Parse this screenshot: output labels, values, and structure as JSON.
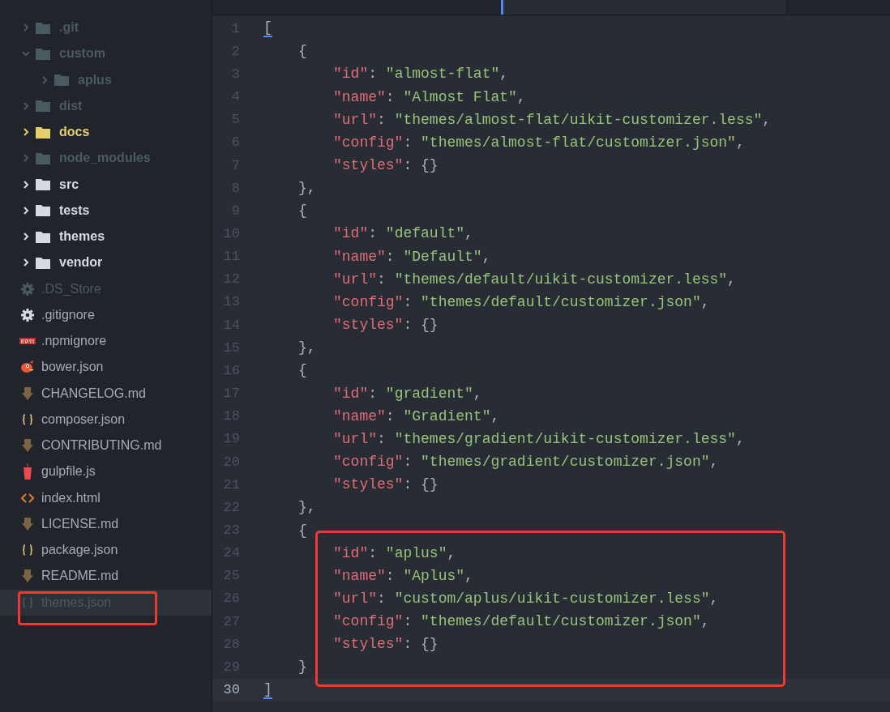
{
  "sidebar": {
    "items": [
      {
        "name": ".git",
        "kind": "folder",
        "ignored": true,
        "modified": false,
        "expanded": false,
        "selected": false
      },
      {
        "name": "custom",
        "kind": "folder",
        "ignored": true,
        "modified": false,
        "expanded": true,
        "selected": false,
        "children": [
          {
            "name": "aplus",
            "kind": "folder",
            "ignored": true,
            "modified": false,
            "expanded": false,
            "selected": false
          }
        ]
      },
      {
        "name": "dist",
        "kind": "folder",
        "ignored": true,
        "modified": false,
        "expanded": false,
        "selected": false
      },
      {
        "name": "docs",
        "kind": "folder",
        "ignored": false,
        "modified": true,
        "expanded": false,
        "selected": false
      },
      {
        "name": "node_modules",
        "kind": "folder",
        "ignored": true,
        "modified": false,
        "expanded": false,
        "selected": false
      },
      {
        "name": "src",
        "kind": "folder",
        "ignored": false,
        "modified": false,
        "expanded": false,
        "selected": false
      },
      {
        "name": "tests",
        "kind": "folder",
        "ignored": false,
        "modified": false,
        "expanded": false,
        "selected": false
      },
      {
        "name": "themes",
        "kind": "folder",
        "ignored": false,
        "modified": false,
        "expanded": false,
        "selected": false
      },
      {
        "name": "vendor",
        "kind": "folder",
        "ignored": false,
        "modified": false,
        "expanded": false,
        "selected": false
      },
      {
        "name": ".DS_Store",
        "kind": "settings",
        "ignored": true,
        "modified": false,
        "selected": false
      },
      {
        "name": ".gitignore",
        "kind": "settings",
        "ignored": false,
        "modified": false,
        "selected": false
      },
      {
        "name": ".npmignore",
        "kind": "npm",
        "ignored": false,
        "modified": false,
        "selected": false
      },
      {
        "name": "bower.json",
        "kind": "bower",
        "ignored": false,
        "modified": false,
        "selected": false
      },
      {
        "name": "CHANGELOG.md",
        "kind": "markdown",
        "ignored": false,
        "modified": false,
        "selected": false
      },
      {
        "name": "composer.json",
        "kind": "json",
        "ignored": false,
        "modified": false,
        "selected": false
      },
      {
        "name": "CONTRIBUTING.md",
        "kind": "markdown",
        "ignored": false,
        "modified": false,
        "selected": false
      },
      {
        "name": "gulpfile.js",
        "kind": "gulp",
        "ignored": false,
        "modified": false,
        "selected": false
      },
      {
        "name": "index.html",
        "kind": "html",
        "ignored": false,
        "modified": false,
        "selected": false
      },
      {
        "name": "LICENSE.md",
        "kind": "markdown",
        "ignored": false,
        "modified": false,
        "selected": false
      },
      {
        "name": "package.json",
        "kind": "json",
        "ignored": false,
        "modified": false,
        "selected": false
      },
      {
        "name": "README.md",
        "kind": "markdown",
        "ignored": false,
        "modified": false,
        "selected": false
      },
      {
        "kind": "highlight",
        "items": [
          {
            "name": "themes.json",
            "kind": "json",
            "ignored": true,
            "modified": false,
            "selected": true
          }
        ]
      }
    ]
  },
  "editor": {
    "lines": [
      {
        "number": "1",
        "kind": "bracket",
        "current": false,
        "tokens": [
          {
            "text": "[",
            "kind": "bracket-match"
          }
        ]
      },
      {
        "number": "2",
        "kind": "brace",
        "current": false,
        "tokens": [
          {
            "text": "{",
            "kind": "punct"
          }
        ]
      },
      {
        "number": "3",
        "kind": "property",
        "current": false,
        "tokens": [
          {
            "text": "\"id\"",
            "kind": "key"
          },
          {
            "text": ": ",
            "kind": "punct"
          },
          {
            "text": "\"almost-flat\"",
            "kind": "string"
          },
          {
            "text": ",",
            "kind": "punct"
          }
        ]
      },
      {
        "number": "4",
        "kind": "property",
        "current": false,
        "tokens": [
          {
            "text": "\"name\"",
            "kind": "key"
          },
          {
            "text": ": ",
            "kind": "punct"
          },
          {
            "text": "\"Almost Flat\"",
            "kind": "string"
          },
          {
            "text": ",",
            "kind": "punct"
          }
        ]
      },
      {
        "number": "5",
        "kind": "property",
        "current": false,
        "tokens": [
          {
            "text": "\"url\"",
            "kind": "key"
          },
          {
            "text": ": ",
            "kind": "punct"
          },
          {
            "text": "\"themes/almost-flat/uikit-customizer.less\"",
            "kind": "string"
          },
          {
            "text": ",",
            "kind": "punct"
          }
        ]
      },
      {
        "number": "6",
        "kind": "property",
        "current": false,
        "tokens": [
          {
            "text": "\"config\"",
            "kind": "key"
          },
          {
            "text": ": ",
            "kind": "punct"
          },
          {
            "text": "\"themes/almost-flat/customizer.json\"",
            "kind": "string"
          },
          {
            "text": ",",
            "kind": "punct"
          }
        ]
      },
      {
        "number": "7",
        "kind": "property",
        "current": false,
        "tokens": [
          {
            "text": "\"styles\"",
            "kind": "key"
          },
          {
            "text": ": {}",
            "kind": "punct"
          }
        ]
      },
      {
        "number": "8",
        "kind": "brace",
        "current": false,
        "tokens": [
          {
            "text": "},",
            "kind": "punct"
          }
        ]
      },
      {
        "number": "9",
        "kind": "brace",
        "current": false,
        "tokens": [
          {
            "text": "{",
            "kind": "punct"
          }
        ]
      },
      {
        "number": "10",
        "kind": "property",
        "current": false,
        "tokens": [
          {
            "text": "\"id\"",
            "kind": "key"
          },
          {
            "text": ": ",
            "kind": "punct"
          },
          {
            "text": "\"default\"",
            "kind": "string"
          },
          {
            "text": ",",
            "kind": "punct"
          }
        ]
      },
      {
        "number": "11",
        "kind": "property",
        "current": false,
        "tokens": [
          {
            "text": "\"name\"",
            "kind": "key"
          },
          {
            "text": ": ",
            "kind": "punct"
          },
          {
            "text": "\"Default\"",
            "kind": "string"
          },
          {
            "text": ",",
            "kind": "punct"
          }
        ]
      },
      {
        "number": "12",
        "kind": "property",
        "current": false,
        "tokens": [
          {
            "text": "\"url\"",
            "kind": "key"
          },
          {
            "text": ": ",
            "kind": "punct"
          },
          {
            "text": "\"themes/default/uikit-customizer.less\"",
            "kind": "string"
          },
          {
            "text": ",",
            "kind": "punct"
          }
        ]
      },
      {
        "number": "13",
        "kind": "property",
        "current": false,
        "tokens": [
          {
            "text": "\"config\"",
            "kind": "key"
          },
          {
            "text": ": ",
            "kind": "punct"
          },
          {
            "text": "\"themes/default/customizer.json\"",
            "kind": "string"
          },
          {
            "text": ",",
            "kind": "punct"
          }
        ]
      },
      {
        "number": "14",
        "kind": "property",
        "current": false,
        "tokens": [
          {
            "text": "\"styles\"",
            "kind": "key"
          },
          {
            "text": ": {}",
            "kind": "punct"
          }
        ]
      },
      {
        "number": "15",
        "kind": "brace",
        "current": false,
        "tokens": [
          {
            "text": "},",
            "kind": "punct"
          }
        ]
      },
      {
        "number": "16",
        "kind": "brace",
        "current": false,
        "tokens": [
          {
            "text": "{",
            "kind": "punct"
          }
        ]
      },
      {
        "number": "17",
        "kind": "property",
        "current": false,
        "tokens": [
          {
            "text": "\"id\"",
            "kind": "key"
          },
          {
            "text": ": ",
            "kind": "punct"
          },
          {
            "text": "\"gradient\"",
            "kind": "string"
          },
          {
            "text": ",",
            "kind": "punct"
          }
        ]
      },
      {
        "number": "18",
        "kind": "property",
        "current": false,
        "tokens": [
          {
            "text": "\"name\"",
            "kind": "key"
          },
          {
            "text": ": ",
            "kind": "punct"
          },
          {
            "text": "\"Gradient\"",
            "kind": "string"
          },
          {
            "text": ",",
            "kind": "punct"
          }
        ]
      },
      {
        "number": "19",
        "kind": "property",
        "current": false,
        "tokens": [
          {
            "text": "\"url\"",
            "kind": "key"
          },
          {
            "text": ": ",
            "kind": "punct"
          },
          {
            "text": "\"themes/gradient/uikit-customizer.less\"",
            "kind": "string"
          },
          {
            "text": ",",
            "kind": "punct"
          }
        ]
      },
      {
        "number": "20",
        "kind": "property",
        "current": false,
        "tokens": [
          {
            "text": "\"config\"",
            "kind": "key"
          },
          {
            "text": ": ",
            "kind": "punct"
          },
          {
            "text": "\"themes/gradient/customizer.json\"",
            "kind": "string"
          },
          {
            "text": ",",
            "kind": "punct"
          }
        ]
      },
      {
        "number": "21",
        "kind": "property",
        "current": false,
        "tokens": [
          {
            "text": "\"styles\"",
            "kind": "key"
          },
          {
            "text": ": {}",
            "kind": "punct"
          }
        ]
      },
      {
        "number": "22",
        "kind": "brace",
        "current": false,
        "tokens": [
          {
            "text": "},",
            "kind": "punct"
          }
        ]
      },
      {
        "number": "23",
        "kind": "brace",
        "current": false,
        "tokens": [
          {
            "text": "{",
            "kind": "punct"
          }
        ]
      },
      {
        "kind": "highlight",
        "lines": [
          {
            "number": "24",
            "kind": "property",
            "current": false,
            "tokens": [
              {
                "text": "\"id\"",
                "kind": "key"
              },
              {
                "text": ": ",
                "kind": "punct"
              },
              {
                "text": "\"aplus\"",
                "kind": "string"
              },
              {
                "text": ",",
                "kind": "punct"
              }
            ]
          },
          {
            "number": "25",
            "kind": "property",
            "current": false,
            "tokens": [
              {
                "text": "\"name\"",
                "kind": "key"
              },
              {
                "text": ": ",
                "kind": "punct"
              },
              {
                "text": "\"Aplus\"",
                "kind": "string"
              },
              {
                "text": ",",
                "kind": "punct"
              }
            ]
          },
          {
            "number": "26",
            "kind": "property",
            "current": false,
            "tokens": [
              {
                "text": "\"url\"",
                "kind": "key"
              },
              {
                "text": ": ",
                "kind": "punct"
              },
              {
                "text": "\"custom/aplus/uikit-customizer.less\"",
                "kind": "string"
              },
              {
                "text": ",",
                "kind": "punct"
              }
            ]
          },
          {
            "number": "27",
            "kind": "property",
            "current": false,
            "tokens": [
              {
                "text": "\"config\"",
                "kind": "key"
              },
              {
                "text": ": ",
                "kind": "punct"
              },
              {
                "text": "\"themes/default/customizer.json\"",
                "kind": "string"
              },
              {
                "text": ",",
                "kind": "punct"
              }
            ]
          },
          {
            "number": "28",
            "kind": "property",
            "current": false,
            "tokens": [
              {
                "text": "\"styles\"",
                "kind": "key"
              },
              {
                "text": ": {}",
                "kind": "punct"
              }
            ]
          },
          {
            "number": "29",
            "kind": "brace",
            "current": false,
            "tokens": [
              {
                "text": "}",
                "kind": "punct"
              }
            ]
          }
        ]
      },
      {
        "number": "30",
        "kind": "bracket",
        "current": true,
        "tokens": [
          {
            "text": "]",
            "kind": "bracket-match"
          }
        ]
      }
    ]
  }
}
